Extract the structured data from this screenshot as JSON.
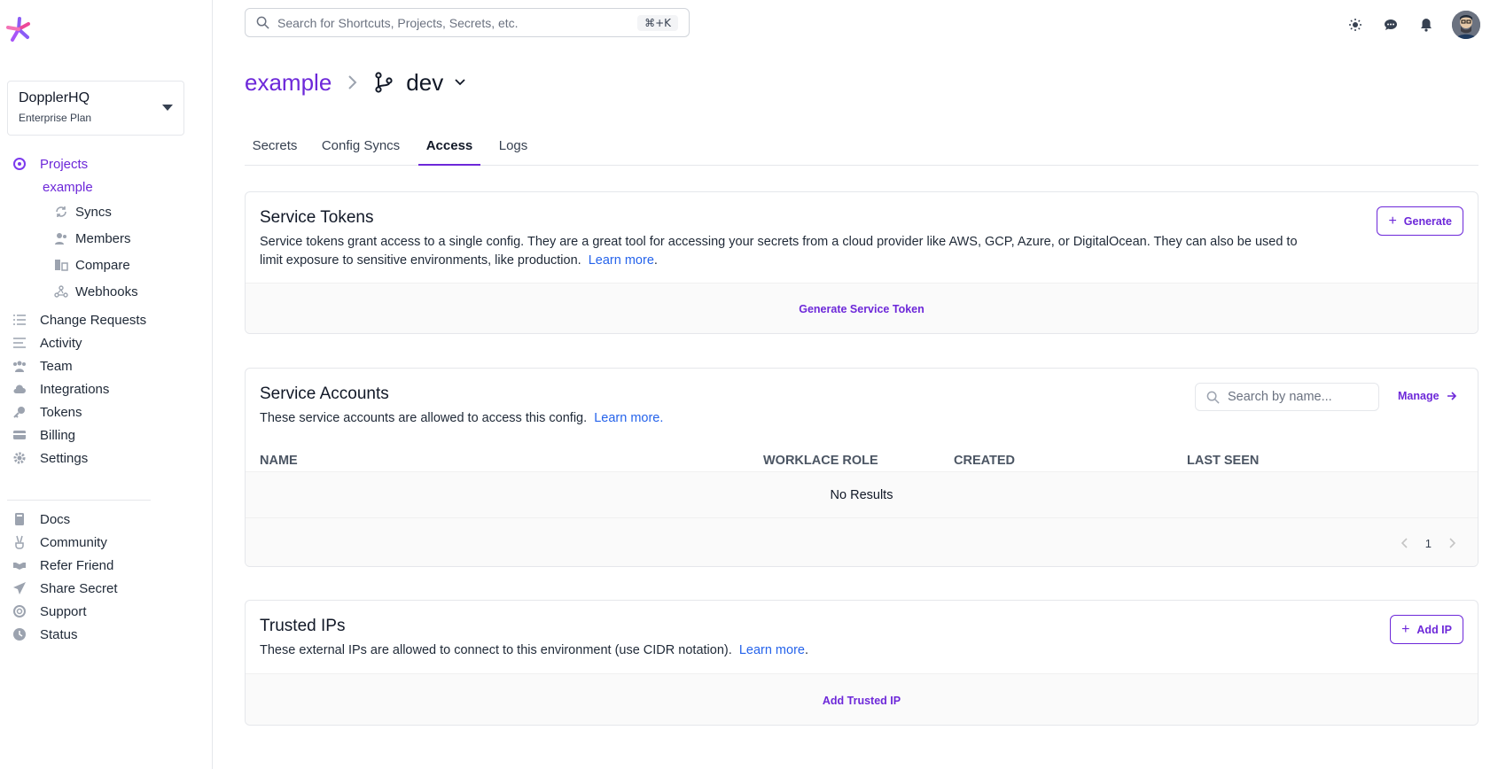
{
  "sidebar": {
    "workspace": {
      "name": "DopplerHQ",
      "plan": "Enterprise Plan"
    },
    "projects_label": "Projects",
    "project_name": "example",
    "sub_items": [
      "Syncs",
      "Members",
      "Compare",
      "Webhooks"
    ],
    "main_items": [
      "Change Requests",
      "Activity",
      "Team",
      "Integrations",
      "Tokens",
      "Billing",
      "Settings"
    ],
    "footer_items": [
      "Docs",
      "Community",
      "Refer Friend",
      "Share Secret",
      "Support",
      "Status"
    ]
  },
  "topbar": {
    "search_placeholder": "Search for Shortcuts, Projects, Secrets, etc.",
    "shortcut": "⌘+K"
  },
  "breadcrumb": {
    "project": "example",
    "config": "dev"
  },
  "tabs": [
    "Secrets",
    "Config Syncs",
    "Access",
    "Logs"
  ],
  "active_tab": "Access",
  "service_tokens": {
    "title": "Service Tokens",
    "description": "Service tokens grant access to a single config. They are a great tool for accessing your secrets from a cloud provider like AWS, GCP, Azure, or DigitalOcean. They can also be used to limit exposure to sensitive environments, like production.",
    "learn_more": "Learn more",
    "generate_button": "Generate",
    "empty_action": "Generate Service Token"
  },
  "service_accounts": {
    "title": "Service Accounts",
    "description": "These service accounts are allowed to access this config.",
    "learn_more": "Learn more",
    "search_placeholder": "Search by name...",
    "manage_label": "Manage",
    "columns": [
      "NAME",
      "WORKLACE ROLE",
      "CREATED",
      "LAST SEEN"
    ],
    "empty_text": "No Results",
    "page": "1"
  },
  "trusted_ips": {
    "title": "Trusted IPs",
    "description": "These external IPs are allowed to connect to this environment (use CIDR notation).",
    "learn_more": "Learn more",
    "add_button": "Add IP",
    "empty_action": "Add Trusted IP"
  },
  "colors": {
    "accent": "#6d28d9",
    "link": "#2563eb"
  }
}
